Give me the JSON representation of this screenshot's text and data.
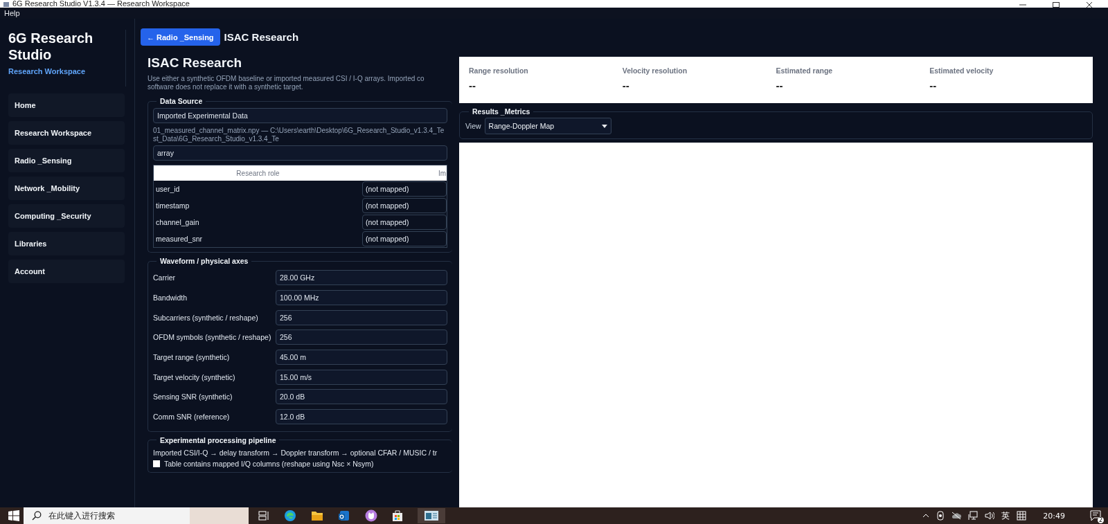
{
  "window": {
    "title": "6G Research Studio V1.3.4 — Research Workspace"
  },
  "menu": [
    "Help"
  ],
  "sidebar": {
    "title": "6G Research Studio",
    "subtitle": "Research Workspace",
    "items": [
      {
        "label": "Home"
      },
      {
        "label": "Research Workspace"
      },
      {
        "label": "Radio _Sensing"
      },
      {
        "label": "Network _Mobility"
      },
      {
        "label": "Computing _Security"
      },
      {
        "label": "Libraries"
      },
      {
        "label": "Account"
      }
    ]
  },
  "header": {
    "back_button": "← Radio _Sensing",
    "title": "ISAC Research"
  },
  "form": {
    "title": "ISAC Research",
    "description": "Use either a synthetic OFDM baseline or imported measured CSI / I-Q arrays. Imported co software does not replace it with a synthetic target.",
    "data_source": {
      "legend": "Data Source",
      "source": "Imported Experimental Data",
      "file": "01_measured_channel_matrix.npy — C:\\Users\\earth\\Desktop\\6G_Research_Studio_v1.3.4_Test_Data\\6G_Research_Studio_v1.3.4_Te",
      "format": "array",
      "columns": [
        "Research role",
        "Im"
      ],
      "rows": [
        {
          "role": "user_id",
          "mapping": "(not mapped)"
        },
        {
          "role": "timestamp",
          "mapping": "(not mapped)"
        },
        {
          "role": "channel_gain",
          "mapping": "(not mapped)"
        },
        {
          "role": "measured_snr",
          "mapping": "(not mapped)"
        }
      ]
    },
    "waveform": {
      "legend": "Waveform / physical axes",
      "fields": [
        {
          "label": "Carrier",
          "value": "28.00 GHz"
        },
        {
          "label": "Bandwidth",
          "value": "100.00 MHz"
        },
        {
          "label": "Subcarriers (synthetic / reshape)",
          "value": "256"
        },
        {
          "label": "OFDM symbols (synthetic / reshape)",
          "value": "256"
        },
        {
          "label": "Target range (synthetic)",
          "value": "45.00 m"
        },
        {
          "label": "Target velocity (synthetic)",
          "value": "15.00 m/s"
        },
        {
          "label": "Sensing SNR (synthetic)",
          "value": "20.0 dB"
        },
        {
          "label": "Comm SNR (reference)",
          "value": "12.0 dB"
        }
      ]
    },
    "pipeline": {
      "legend": "Experimental processing pipeline",
      "text": "Imported CSI/I-Q → delay transform → Doppler transform → optional CFAR / MUSIC / tr",
      "options": [
        {
          "label": "Table contains mapped I/Q columns (reshape using Nsc × Nsym)",
          "checked": false
        }
      ]
    }
  },
  "metrics": [
    {
      "label": "Range resolution",
      "value": "--"
    },
    {
      "label": "Velocity resolution",
      "value": "--"
    },
    {
      "label": "Estimated range",
      "value": "--"
    },
    {
      "label": "Estimated velocity",
      "value": "--"
    }
  ],
  "results": {
    "legend": "Results _Metrics",
    "view_label": "View",
    "view": "Range-Doppler Map"
  },
  "taskbar": {
    "search_placeholder": "在此键入进行搜索",
    "ime": "英",
    "time": "20:49",
    "notifications": "2"
  }
}
